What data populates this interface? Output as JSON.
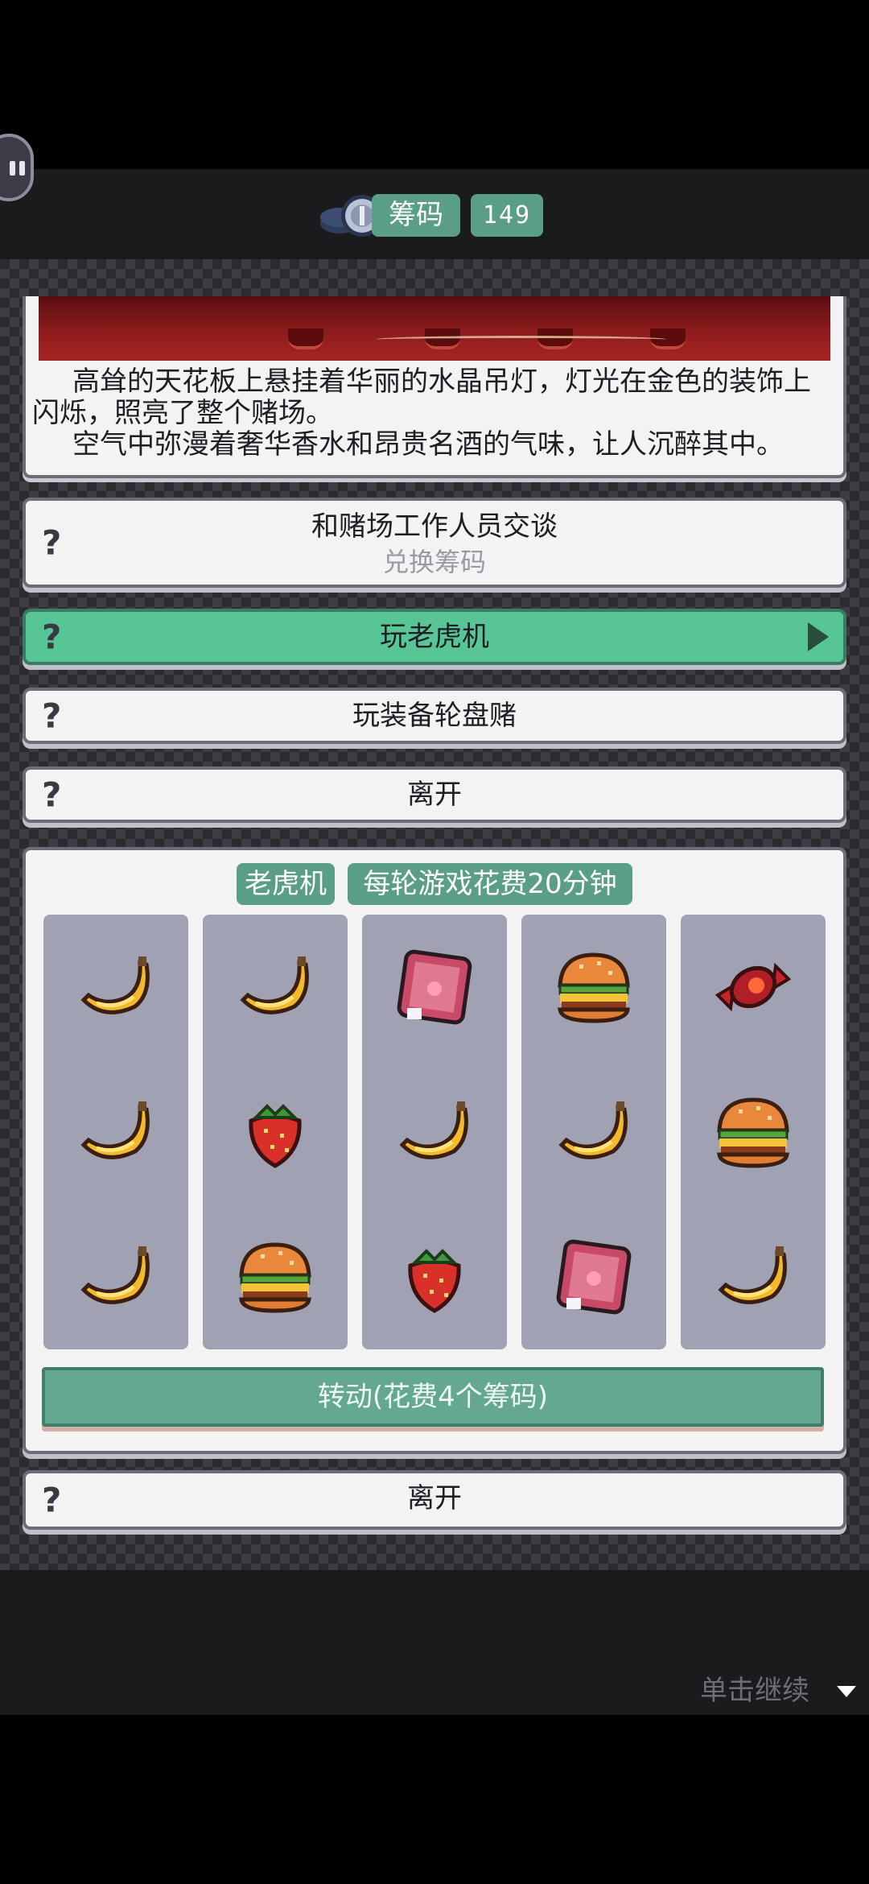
{
  "header": {
    "chip_label": "筹码",
    "chip_count": "149"
  },
  "story": {
    "lines": [
      "高耸的天花板上悬挂着华丽的水晶吊灯，灯光在金色的装饰上闪烁，照亮了整个赌场。",
      "空气中弥漫着奢华香水和昂贵名酒的气味，让人沉醉其中。"
    ]
  },
  "options": {
    "talk": {
      "label": "和赌场工作人员交谈",
      "sub": "兑换筹码"
    },
    "slot": "玩老虎机",
    "roulette": "玩装备轮盘赌",
    "leave": "离开"
  },
  "slot_machine": {
    "title": "老虎机",
    "cost_note": "每轮游戏花费20分钟",
    "reels": [
      [
        "banana-icon",
        "banana-icon",
        "banana-icon"
      ],
      [
        "banana-icon",
        "strawberry-icon",
        "burger-icon"
      ],
      [
        "gem-icon",
        "banana-icon",
        "strawberry-icon"
      ],
      [
        "burger-icon",
        "banana-icon",
        "gem-icon"
      ],
      [
        "candy-icon",
        "burger-icon",
        "banana-icon"
      ]
    ],
    "spin_label": "转动(花费4个筹码)"
  },
  "footer": {
    "leave": "离开",
    "continue": "单击继续"
  },
  "colors": {
    "accent": "#58c596",
    "chip_tag": "#5a9e86",
    "reel_bg": "#a0a2b4"
  }
}
